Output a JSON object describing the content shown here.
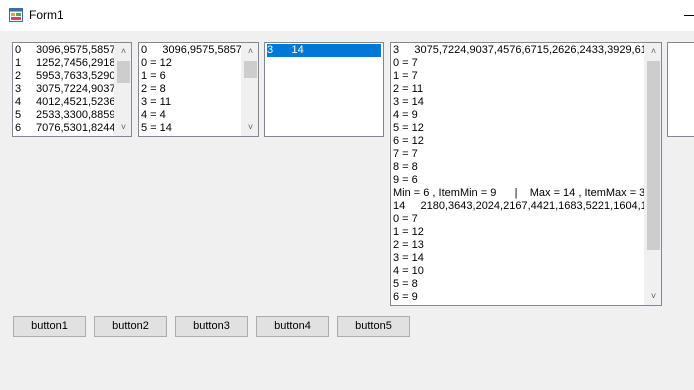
{
  "window": {
    "title": "Form1"
  },
  "listbox1": {
    "items": [
      [
        "0",
        "3096,9575,5857"
      ],
      [
        "1",
        "1252,7456,2918"
      ],
      [
        "2",
        "5953,7633,5290"
      ],
      [
        "3",
        "3075,7224,9037"
      ],
      [
        "4",
        "4012,4521,5236"
      ],
      [
        "5",
        "2533,3300,8859"
      ],
      [
        "6",
        "7076,5301,8244"
      ]
    ]
  },
  "listbox2": {
    "items": [
      "0     3096,9575,5857",
      "0 = 12",
      "1 = 6",
      "2 = 8",
      "3 = 11",
      "4 = 4",
      "5 = 14"
    ]
  },
  "listbox3": {
    "items": [
      "3      14"
    ]
  },
  "listbox4": {
    "items": [
      "3     3075,7224,9037,4576,6715,2626,2433,3929,61",
      "0 = 7",
      "1 = 7",
      "2 = 11",
      "3 = 14",
      "4 = 9",
      "5 = 12",
      "6 = 12",
      "7 = 7",
      "8 = 8",
      "9 = 6",
      "Min = 6 , ItemMin = 9      |    Max = 14 , ItemMax = 3",
      "14     2180,3643,2024,2167,4421,1683,5221,1604,1",
      "0 = 7",
      "1 = 12",
      "2 = 13",
      "3 = 14",
      "4 = 10",
      "5 = 8",
      "6 = 9"
    ]
  },
  "buttons": [
    "button1",
    "button2",
    "button3",
    "button4",
    "button5"
  ]
}
